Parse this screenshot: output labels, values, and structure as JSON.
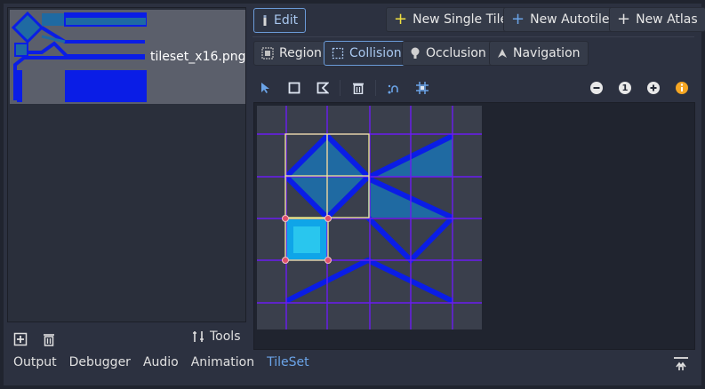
{
  "left_panel": {
    "tile_name": "tileset_x16.png",
    "tools_label": "Tools",
    "icons": [
      "add-tile-icon",
      "trash-icon",
      "tools-icon"
    ]
  },
  "toolbar_top": {
    "edit_label": "Edit",
    "new_single_label": "New Single Tile",
    "new_autotile_label": "New Autotile",
    "new_atlas_label": "New Atlas"
  },
  "tabs": {
    "region_label": "Region",
    "collision_label": "Collision",
    "occlusion_label": "Occlusion",
    "navigation_label": "Navigation",
    "active": "Collision"
  },
  "tools": {
    "icons": [
      "select-arrow-icon",
      "rectangle-icon",
      "polygon-icon",
      "delete-icon",
      "snap-icon",
      "grid-snap-icon"
    ],
    "zoom_reset_label": "1",
    "zoom_icons": [
      "zoom-out-icon",
      "zoom-reset-icon",
      "zoom-in-icon",
      "info-icon"
    ]
  },
  "dock": {
    "tabs": [
      "Output",
      "Debugger",
      "Audio",
      "Animation",
      "TileSet"
    ],
    "active": "TileSet"
  },
  "colors": {
    "accent": "#6ba4e8",
    "tile_blue": "#0a1de6",
    "tile_teal": "#1f6aa2",
    "selection": "#f0f08c",
    "handle": "#e0506a",
    "grid": "#6a1cf2",
    "warning": "#f5a623"
  }
}
